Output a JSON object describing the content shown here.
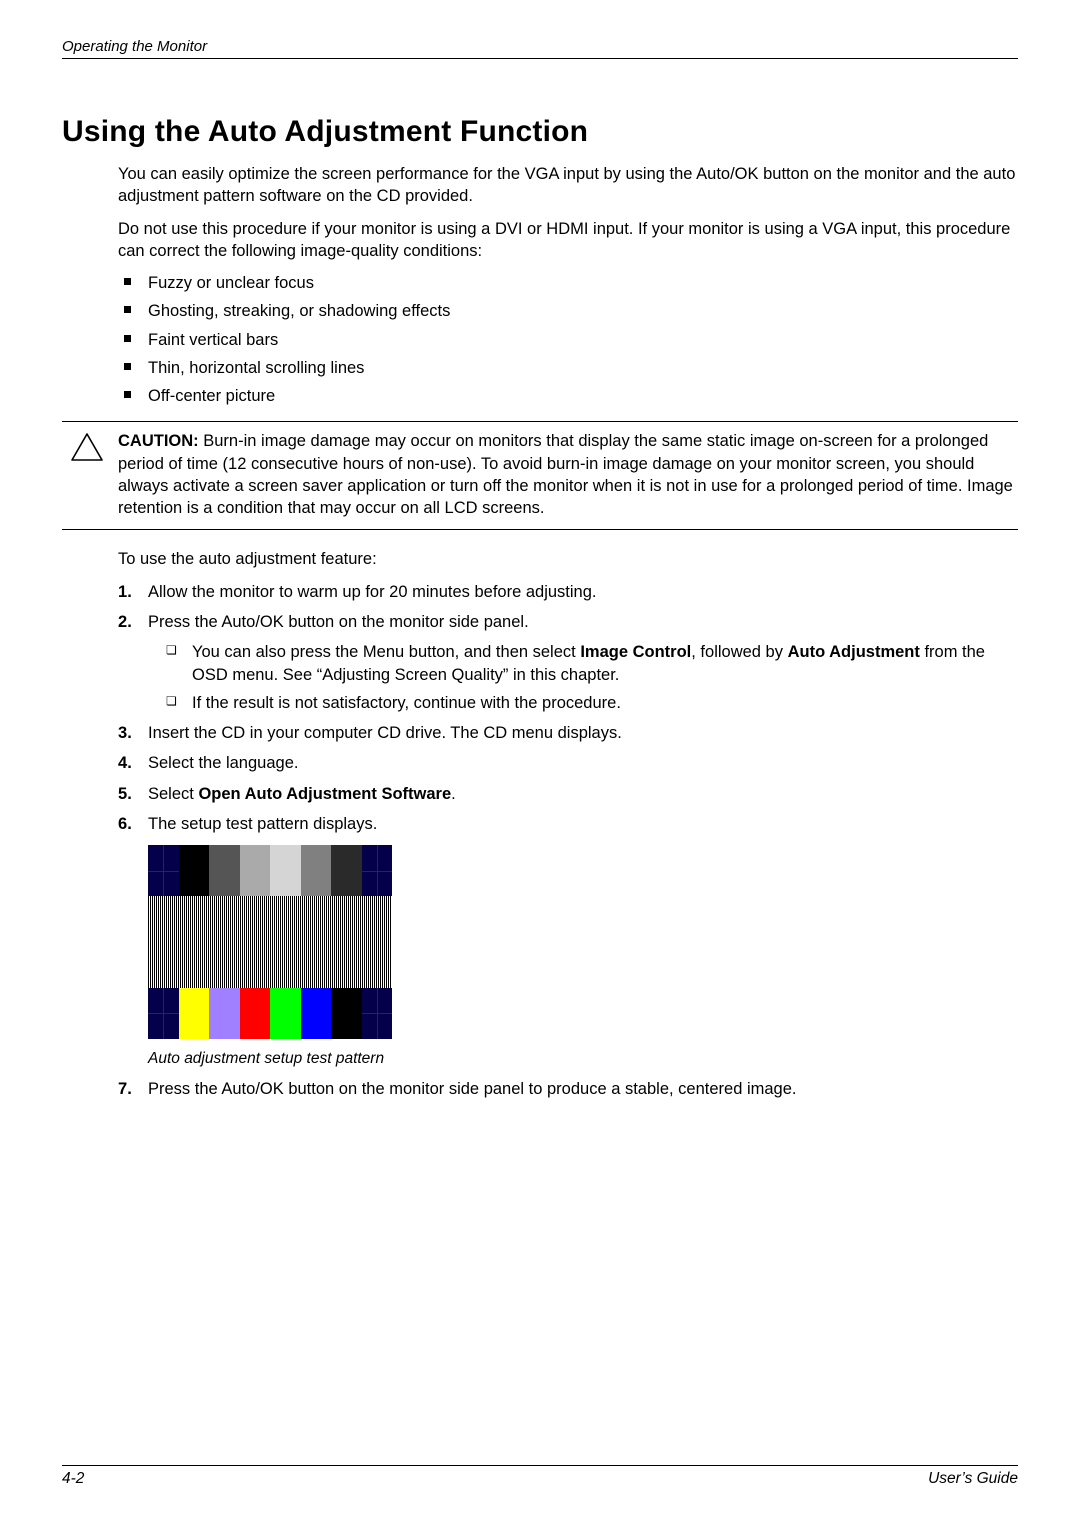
{
  "header": {
    "section": "Operating the Monitor"
  },
  "title": "Using the Auto Adjustment Function",
  "intro1": "You can easily optimize the screen performance for the VGA input by using the Auto/OK button on the monitor and the auto adjustment pattern software on the CD provided.",
  "intro2": "Do not use this procedure if your monitor is using a DVI or HDMI input. If your monitor is using a VGA input, this procedure can correct the following image-quality conditions:",
  "conditions": [
    "Fuzzy or unclear focus",
    "Ghosting, streaking, or shadowing effects",
    "Faint vertical bars",
    "Thin, horizontal scrolling lines",
    "Off-center picture"
  ],
  "caution": {
    "label": "CAUTION:",
    "text": "Burn-in image damage may occur on monitors that display the same static image on-screen for a prolonged period of time (12 consecutive hours of non-use). To avoid burn-in image damage on your monitor screen, you should always activate a screen saver application or turn off the monitor when it is not in use for a prolonged period of time. Image retention is a condition that may occur on all LCD screens."
  },
  "use_intro": "To use the auto adjustment feature:",
  "steps": {
    "s1": "Allow the monitor to warm up for 20 minutes before adjusting.",
    "s2": "Press the Auto/OK button on the monitor side panel.",
    "s2a_pre": "You can also press the Menu button, and then select ",
    "s2a_b1": "Image Control",
    "s2a_mid": ", followed by ",
    "s2a_b2": "Auto Adjustment",
    "s2a_post": " from the OSD menu. See “Adjusting Screen Quality” in this chapter.",
    "s2b": "If the result is not satisfactory, continue with the procedure.",
    "s3": "Insert the CD in your computer CD drive. The CD menu displays.",
    "s4": "Select the language.",
    "s5_pre": "Select ",
    "s5_b": "Open Auto Adjustment Software",
    "s5_post": ".",
    "s6": "The setup test pattern displays.",
    "s7": "Press the Auto/OK button on the monitor side panel to produce a stable, centered image."
  },
  "figure_caption": "Auto adjustment setup test pattern",
  "footer": {
    "page": "4-2",
    "doc": "User’s Guide"
  }
}
